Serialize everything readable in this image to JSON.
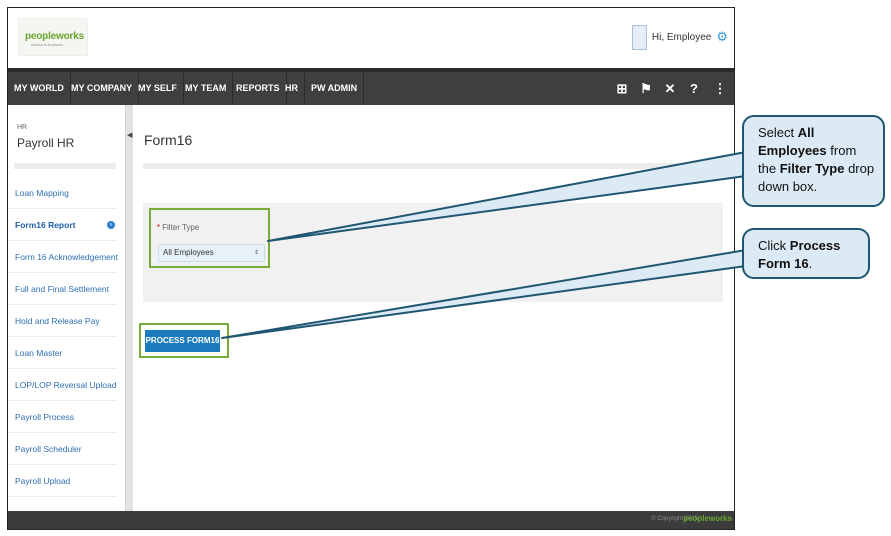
{
  "header": {
    "logo_text": "peopleworks",
    "logo_tagline": "PEOPLE IN BUSINESS",
    "greeting": "Hi, Employee"
  },
  "nav": {
    "items": [
      "MY WORLD",
      "MY COMPANY",
      "MY SELF",
      "MY TEAM",
      "REPORTS",
      "HR",
      "PW ADMIN"
    ],
    "icons": [
      "book-icon",
      "flag-icon",
      "tools-icon",
      "help-icon",
      "share-icon"
    ]
  },
  "sidebar": {
    "section_small": "HR",
    "section_title": "Payroll HR",
    "items": [
      {
        "label": "Loan Mapping"
      },
      {
        "label": "Form16 Report"
      },
      {
        "label": "Form 16 Acknowledgement"
      },
      {
        "label": "Full and Final Settlement"
      },
      {
        "label": "Hold and Release Pay"
      },
      {
        "label": "Loan Master"
      },
      {
        "label": "LOP/LOP Reversal Upload"
      },
      {
        "label": "Payroll Process"
      },
      {
        "label": "Payroll Scheduler"
      },
      {
        "label": "Payroll Upload"
      }
    ],
    "active_index": 1
  },
  "main": {
    "page_title": "Form16",
    "filter_label": "Filter Type",
    "filter_value": "All Employees",
    "process_button": "PROCESS FORM16"
  },
  "footer": {
    "copyright": "© Copyright 2015",
    "logo_text": "peopleworks"
  },
  "callouts": {
    "c1": {
      "t1": "Select ",
      "b1": "All Employees",
      "t2": " from the ",
      "b2": "Filter Type",
      "t3": " drop down box."
    },
    "c2": {
      "t1": "Click ",
      "b1": "Process Form 16",
      "t2": "."
    }
  },
  "colors": {
    "nav_bg": "#3f3f3f",
    "highlight_border": "#7aab3b",
    "button_bg": "#1b7bbd",
    "callout_bg": "#dceaf5",
    "callout_border": "#1f5671"
  }
}
